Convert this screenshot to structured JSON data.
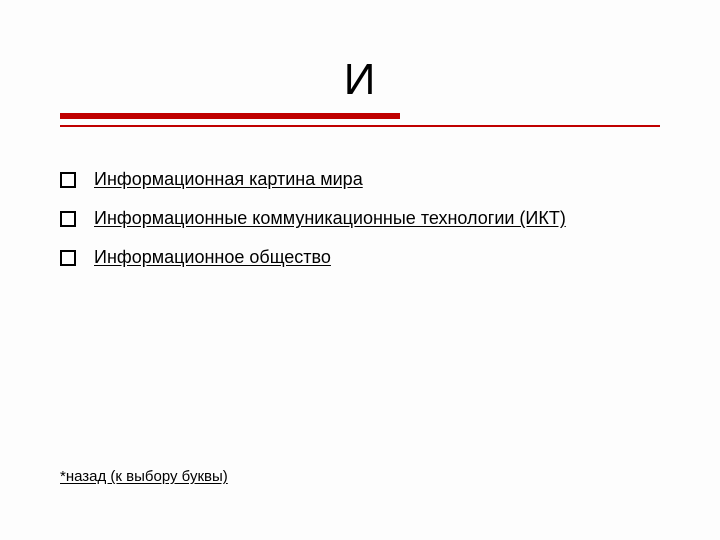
{
  "title": "И",
  "colors": {
    "accent": "#c00000",
    "text": "#000000",
    "background": "#fdfdfd"
  },
  "items": [
    {
      "label": "Информационная картина мира"
    },
    {
      "label": "Информационные коммуникационные технологии (ИКТ)"
    },
    {
      "label": "Информационное общество"
    }
  ],
  "back_label": "*назад (к выбору буквы)"
}
